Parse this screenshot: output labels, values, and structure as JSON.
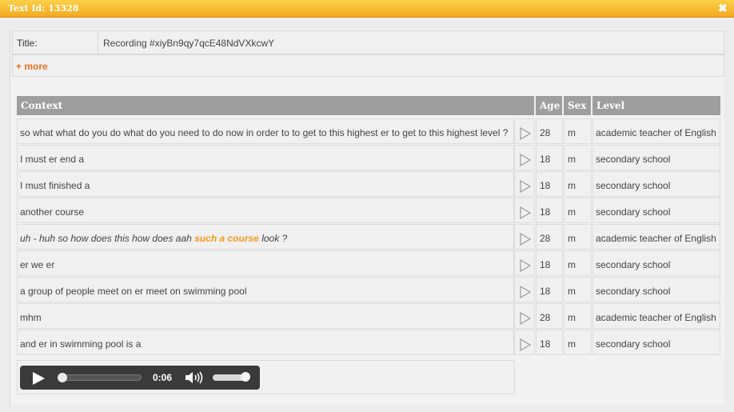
{
  "window": {
    "title": "Text Id: 13328",
    "close_glyph": "✖"
  },
  "meta": {
    "title_label": "Title:",
    "title_value": "Recording #xiyBn9qy7qcE48NdVXkcwY",
    "more_label": "+ more"
  },
  "table": {
    "headers": {
      "context": "Context",
      "age": "Age",
      "sex": "Sex",
      "level": "Level"
    },
    "rows": [
      {
        "context": "so what what do you do what do you need to do now in order to to get to this highest er to get to this highest level ?",
        "age": "28",
        "sex": "m",
        "level": "academic teacher of English"
      },
      {
        "context": "I must er end a",
        "age": "18",
        "sex": "m",
        "level": "secondary school"
      },
      {
        "context": "I must finished a",
        "age": "18",
        "sex": "m",
        "level": "secondary school"
      },
      {
        "context": "another course",
        "age": "18",
        "sex": "m",
        "level": "secondary school"
      },
      {
        "context_pre": "uh - huh so how does this how does aah ",
        "context_hl": "such a course",
        "context_post": " look ?",
        "age": "28",
        "sex": "m",
        "level": "academic teacher of English"
      },
      {
        "context": "er we er",
        "age": "18",
        "sex": "m",
        "level": "secondary school"
      },
      {
        "context": "a group of people meet on er meet on swimming pool",
        "age": "18",
        "sex": "m",
        "level": "secondary school"
      },
      {
        "context": "mhm",
        "age": "28",
        "sex": "m",
        "level": "academic teacher of English"
      },
      {
        "context": "and er in swimming pool is a",
        "age": "18",
        "sex": "m",
        "level": "secondary school"
      }
    ]
  },
  "player": {
    "time": "0:06",
    "progress": 0.0,
    "volume": 1.0
  },
  "colors": {
    "accent": "#f39a1e",
    "titlebar": "#f3a91e",
    "header": "#9e9e9e"
  }
}
